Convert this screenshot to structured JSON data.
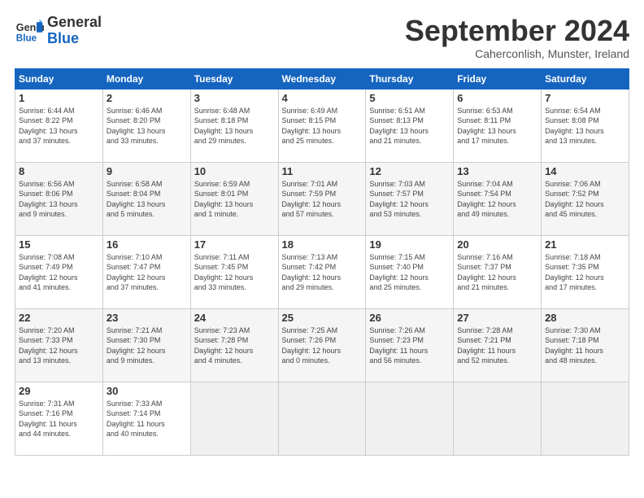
{
  "header": {
    "logo_line1": "General",
    "logo_line2": "Blue",
    "month_title": "September 2024",
    "subtitle": "Caherconlish, Munster, Ireland"
  },
  "weekdays": [
    "Sunday",
    "Monday",
    "Tuesday",
    "Wednesday",
    "Thursday",
    "Friday",
    "Saturday"
  ],
  "weeks": [
    [
      {
        "day": "1",
        "info": "Sunrise: 6:44 AM\nSunset: 8:22 PM\nDaylight: 13 hours\nand 37 minutes."
      },
      {
        "day": "2",
        "info": "Sunrise: 6:46 AM\nSunset: 8:20 PM\nDaylight: 13 hours\nand 33 minutes."
      },
      {
        "day": "3",
        "info": "Sunrise: 6:48 AM\nSunset: 8:18 PM\nDaylight: 13 hours\nand 29 minutes."
      },
      {
        "day": "4",
        "info": "Sunrise: 6:49 AM\nSunset: 8:15 PM\nDaylight: 13 hours\nand 25 minutes."
      },
      {
        "day": "5",
        "info": "Sunrise: 6:51 AM\nSunset: 8:13 PM\nDaylight: 13 hours\nand 21 minutes."
      },
      {
        "day": "6",
        "info": "Sunrise: 6:53 AM\nSunset: 8:11 PM\nDaylight: 13 hours\nand 17 minutes."
      },
      {
        "day": "7",
        "info": "Sunrise: 6:54 AM\nSunset: 8:08 PM\nDaylight: 13 hours\nand 13 minutes."
      }
    ],
    [
      {
        "day": "8",
        "info": "Sunrise: 6:56 AM\nSunset: 8:06 PM\nDaylight: 13 hours\nand 9 minutes."
      },
      {
        "day": "9",
        "info": "Sunrise: 6:58 AM\nSunset: 8:04 PM\nDaylight: 13 hours\nand 5 minutes."
      },
      {
        "day": "10",
        "info": "Sunrise: 6:59 AM\nSunset: 8:01 PM\nDaylight: 13 hours\nand 1 minute."
      },
      {
        "day": "11",
        "info": "Sunrise: 7:01 AM\nSunset: 7:59 PM\nDaylight: 12 hours\nand 57 minutes."
      },
      {
        "day": "12",
        "info": "Sunrise: 7:03 AM\nSunset: 7:57 PM\nDaylight: 12 hours\nand 53 minutes."
      },
      {
        "day": "13",
        "info": "Sunrise: 7:04 AM\nSunset: 7:54 PM\nDaylight: 12 hours\nand 49 minutes."
      },
      {
        "day": "14",
        "info": "Sunrise: 7:06 AM\nSunset: 7:52 PM\nDaylight: 12 hours\nand 45 minutes."
      }
    ],
    [
      {
        "day": "15",
        "info": "Sunrise: 7:08 AM\nSunset: 7:49 PM\nDaylight: 12 hours\nand 41 minutes."
      },
      {
        "day": "16",
        "info": "Sunrise: 7:10 AM\nSunset: 7:47 PM\nDaylight: 12 hours\nand 37 minutes."
      },
      {
        "day": "17",
        "info": "Sunrise: 7:11 AM\nSunset: 7:45 PM\nDaylight: 12 hours\nand 33 minutes."
      },
      {
        "day": "18",
        "info": "Sunrise: 7:13 AM\nSunset: 7:42 PM\nDaylight: 12 hours\nand 29 minutes."
      },
      {
        "day": "19",
        "info": "Sunrise: 7:15 AM\nSunset: 7:40 PM\nDaylight: 12 hours\nand 25 minutes."
      },
      {
        "day": "20",
        "info": "Sunrise: 7:16 AM\nSunset: 7:37 PM\nDaylight: 12 hours\nand 21 minutes."
      },
      {
        "day": "21",
        "info": "Sunrise: 7:18 AM\nSunset: 7:35 PM\nDaylight: 12 hours\nand 17 minutes."
      }
    ],
    [
      {
        "day": "22",
        "info": "Sunrise: 7:20 AM\nSunset: 7:33 PM\nDaylight: 12 hours\nand 13 minutes."
      },
      {
        "day": "23",
        "info": "Sunrise: 7:21 AM\nSunset: 7:30 PM\nDaylight: 12 hours\nand 9 minutes."
      },
      {
        "day": "24",
        "info": "Sunrise: 7:23 AM\nSunset: 7:28 PM\nDaylight: 12 hours\nand 4 minutes."
      },
      {
        "day": "25",
        "info": "Sunrise: 7:25 AM\nSunset: 7:26 PM\nDaylight: 12 hours\nand 0 minutes."
      },
      {
        "day": "26",
        "info": "Sunrise: 7:26 AM\nSunset: 7:23 PM\nDaylight: 11 hours\nand 56 minutes."
      },
      {
        "day": "27",
        "info": "Sunrise: 7:28 AM\nSunset: 7:21 PM\nDaylight: 11 hours\nand 52 minutes."
      },
      {
        "day": "28",
        "info": "Sunrise: 7:30 AM\nSunset: 7:18 PM\nDaylight: 11 hours\nand 48 minutes."
      }
    ],
    [
      {
        "day": "29",
        "info": "Sunrise: 7:31 AM\nSunset: 7:16 PM\nDaylight: 11 hours\nand 44 minutes."
      },
      {
        "day": "30",
        "info": "Sunrise: 7:33 AM\nSunset: 7:14 PM\nDaylight: 11 hours\nand 40 minutes."
      },
      {
        "day": "",
        "info": ""
      },
      {
        "day": "",
        "info": ""
      },
      {
        "day": "",
        "info": ""
      },
      {
        "day": "",
        "info": ""
      },
      {
        "day": "",
        "info": ""
      }
    ]
  ]
}
